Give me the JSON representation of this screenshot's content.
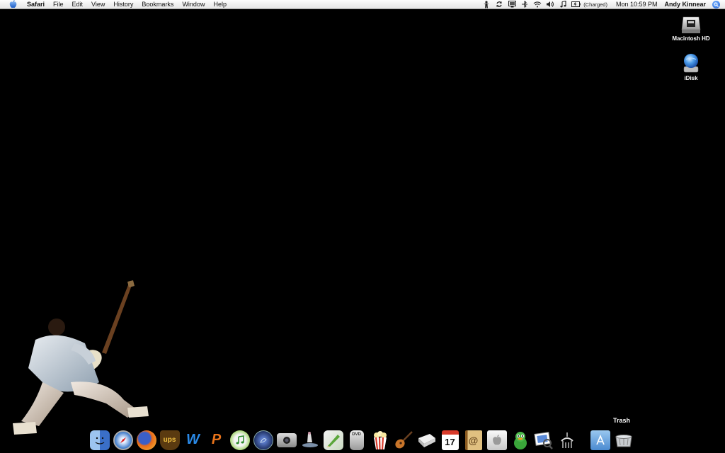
{
  "menubar": {
    "app_name": "Safari",
    "menus": [
      "File",
      "Edit",
      "View",
      "History",
      "Bookmarks",
      "Window",
      "Help"
    ],
    "status_icons": [
      "accessibility-icon",
      "sync-icon",
      "display-icon",
      "bluetooth-icon",
      "wifi-icon",
      "volume-icon",
      "itunes-icon",
      "battery-icon"
    ],
    "battery_status": "(Charged)",
    "clock": "Mon 10:59 PM",
    "user": "Andy Kinnear"
  },
  "desktop_icons": [
    {
      "label": "Macintosh HD",
      "icon": "hard-drive-icon"
    },
    {
      "label": "iDisk",
      "icon": "idisk-icon"
    }
  ],
  "dock": {
    "items": [
      {
        "name": "finder",
        "icon": "finder-icon",
        "color": "#4a7fd4"
      },
      {
        "name": "safari",
        "icon": "safari-icon",
        "color": "#3a78c8"
      },
      {
        "name": "firefox",
        "icon": "firefox-icon",
        "color": "#e86a1a"
      },
      {
        "name": "ups",
        "icon": "ups-icon",
        "color": "#6b4a1a",
        "text": "ups"
      },
      {
        "name": "w-app",
        "icon": "w-app-icon",
        "color": "#1e7fd6",
        "text": "W"
      },
      {
        "name": "p-app",
        "icon": "p-app-icon",
        "color": "#e8731a",
        "text": "P"
      },
      {
        "name": "itunes",
        "icon": "itunes-icon",
        "color": "#6fbf3a"
      },
      {
        "name": "quicktime",
        "icon": "quicktime-icon",
        "color": "#2a3f7a"
      },
      {
        "name": "camera",
        "icon": "camera-icon",
        "color": "#888888"
      },
      {
        "name": "skater",
        "icon": "skater-icon",
        "color": "#7b8fa8"
      },
      {
        "name": "pencil",
        "icon": "pencil-icon",
        "color": "#5aa63a"
      },
      {
        "name": "dvd-player",
        "icon": "dvd-player-icon",
        "color": "#bdbdbd",
        "text": "DVD"
      },
      {
        "name": "popcorn",
        "icon": "popcorn-icon",
        "color": "#d83a2a"
      },
      {
        "name": "garageband",
        "icon": "guitar-icon",
        "color": "#b06a2a"
      },
      {
        "name": "drive",
        "icon": "drive-icon",
        "color": "#dcdcdc"
      },
      {
        "name": "ical",
        "icon": "calendar-icon",
        "color": "#ffffff",
        "text": "17"
      },
      {
        "name": "address-book",
        "icon": "address-book-icon",
        "color": "#c79a4a",
        "text": "@"
      },
      {
        "name": "apple-store",
        "icon": "apple-store-icon",
        "color": "#e8e8e8"
      },
      {
        "name": "adium",
        "icon": "duck-icon",
        "color": "#3aa63a"
      },
      {
        "name": "preview",
        "icon": "preview-icon",
        "color": "#4a7fd4"
      },
      {
        "name": "utility",
        "icon": "utility-icon",
        "color": "#333333"
      }
    ],
    "right_items": [
      {
        "name": "applications",
        "icon": "applications-folder-icon",
        "color": "#5a9ad8"
      },
      {
        "name": "trash",
        "icon": "trash-icon",
        "color": "#888888"
      }
    ],
    "tooltip": "Trash"
  }
}
